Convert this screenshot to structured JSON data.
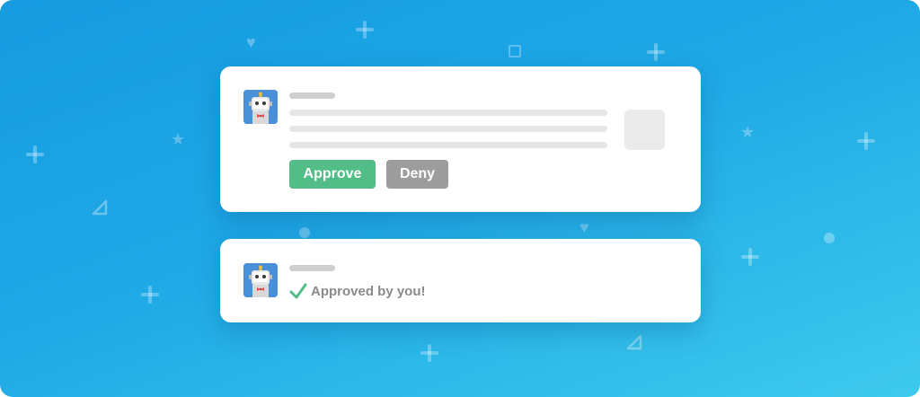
{
  "request_card": {
    "approve_label": "Approve",
    "deny_label": "Deny"
  },
  "result_card": {
    "status_text": "Approved by you!"
  },
  "colors": {
    "background_start": "#169be0",
    "background_end": "#3ec9ee",
    "approve": "#52bd86",
    "deny": "#9d9d9d",
    "check": "#52bd86",
    "avatar": "#4a90d9"
  },
  "icons": [
    "robot-avatar-icon",
    "checkmark-icon",
    "plus-icon",
    "heart-icon",
    "star-icon",
    "square-icon",
    "triangle-icon",
    "dot-icon"
  ]
}
